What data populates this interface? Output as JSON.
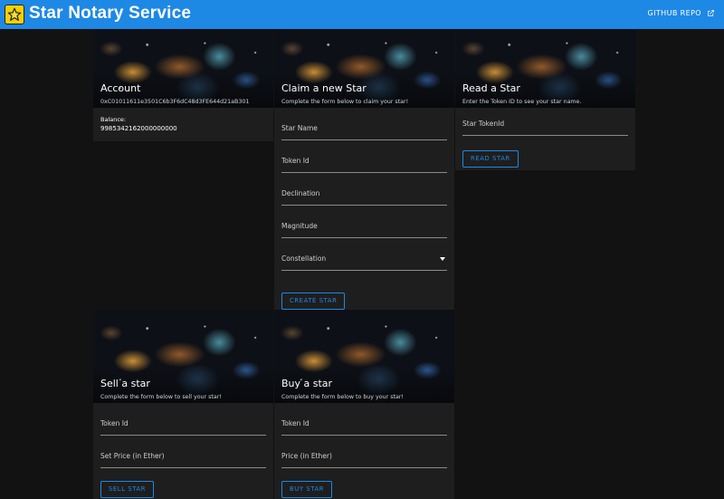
{
  "app": {
    "title": "Star Notary Service",
    "repo_link": "GITHUB REPO",
    "accent_color": "#1e88e5"
  },
  "account": {
    "title": "Account",
    "address": "0xC01011611e3501C6b3F6dC48d3FE644d21aB301",
    "balance_label": "Balance:",
    "balance_value": "9985342162000000000"
  },
  "claim": {
    "title": "Claim a new Star",
    "subtitle": "Complete the form below to claim your star!",
    "fields": [
      "Star Name",
      "Token Id",
      "Declination",
      "Magnitude",
      "Constellation"
    ],
    "button": "CREATE STAR"
  },
  "read": {
    "title": "Read a Star",
    "subtitle": "Enter the Token ID to see your star name.",
    "fields": [
      "Star TokenId"
    ],
    "button": "READ STAR"
  },
  "sell": {
    "title": "Sell a star",
    "subtitle": "Complete the form below to sell your star!",
    "fields": [
      "Token Id",
      "Set Price (in Ether)"
    ],
    "button": "SELL STAR"
  },
  "buy": {
    "title": "Buy a star",
    "subtitle": "Complete the form below to buy your star!",
    "fields": [
      "Token Id",
      "Price (in Ether)"
    ],
    "button": "BUY STAR"
  },
  "icons": {
    "logo": "star-logo-icon",
    "external": "external-link-icon",
    "select": "dropdown-arrow-icon"
  }
}
